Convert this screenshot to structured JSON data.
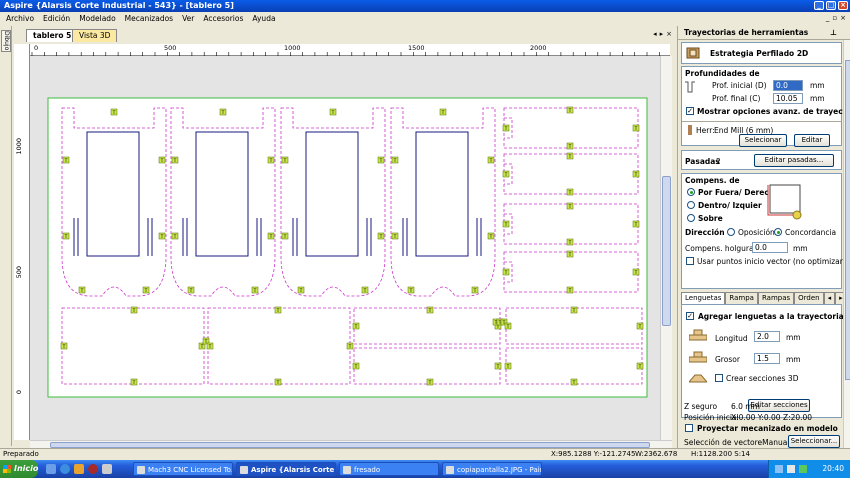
{
  "window": {
    "title": "Aspire {Alarsis Corte Industrial - 543} - [tablero 5]"
  },
  "menu": [
    "Archivo",
    "Edición",
    "Modelado",
    "Mecanizados",
    "Ver",
    "Accesorios",
    "Ayuda"
  ],
  "left_tab": "Dibujo",
  "doc_tabs": {
    "active": "tablero 5",
    "other": "Vista 3D"
  },
  "rulers": {
    "h": [
      "0",
      "500",
      "1000",
      "1500",
      "2000"
    ],
    "v": [
      "1000",
      "500",
      "0"
    ]
  },
  "tab_marker": "T",
  "panel": {
    "title": "Trayectorias de herramientas",
    "strategy": "Estrategia Perfilado 2D",
    "depths": {
      "heading": "Profundidades de",
      "start_label": "Prof. inicial (D)",
      "start_value": "0.0",
      "end_label": "Prof. final (C)",
      "end_value": "10.05",
      "unit": "mm",
      "advanced_label": "Mostrar opciones avanz. de trayectori"
    },
    "tool": {
      "label": "Herr:",
      "name": "End Mill (6 mm)",
      "select_btn": "Selecionar",
      "edit_btn": "Editar"
    },
    "passes": {
      "label": "Pasadas",
      "value": "2",
      "btn": "Editar pasadas..."
    },
    "comp": {
      "heading": "Compens. de",
      "outside": "Por Fuera/ Derec",
      "inside": "Dentro/ Izquier",
      "on": "Sobre",
      "direction_label": "Dirección",
      "opposite": "Oposición",
      "climb": "Concordancia",
      "allowance_label": "Compens. holgura",
      "allowance_value": "0.0",
      "unit": "mm",
      "start_point": "Usar puntos inicio vector (no optimizar)"
    },
    "tabs": [
      "Lenguetas",
      "Rampa L.",
      "Rampas",
      "Orden"
    ],
    "lenguetas": {
      "add_label": "Agregar lenguetas a la trayectoria",
      "length_label": "Longitud",
      "length_value": "2.0",
      "thickness_label": "Grosor",
      "thickness_value": "1.5",
      "unit": "mm",
      "create3d_label": "Crear secciones 3D",
      "edit_btn": "Editar secciones"
    },
    "safe_z": {
      "label": "Z seguro",
      "value": "6.0 mm"
    },
    "home": {
      "label": "Posición inicial",
      "value": "X:0.00 Y:0.00 Z:20.00"
    },
    "project_label": "Proyectar mecanizado en modelo",
    "vector_sel": {
      "label": "Selección de vectoreManual",
      "btn": "Seleccionar..."
    }
  },
  "status": {
    "ready": "Preparado",
    "coords": "X:985.1288 Y:-121.2745",
    "size": "W:2362.678",
    "height": "H:1128.200 S:14"
  },
  "taskbar": {
    "start": "Inicio",
    "tasks": [
      "Mach3 CNC Licensed To...",
      "Aspire {Alarsis Corte ...",
      "fresado",
      "copiapantalla2.JPG - Paint"
    ],
    "clock": "20:40"
  },
  "colors": {
    "toolpath": "#cc33cc",
    "vector": "#1a1a80",
    "tab": "#c8e64a",
    "board": "#ffffff",
    "board_border": "#3dbb3d"
  }
}
